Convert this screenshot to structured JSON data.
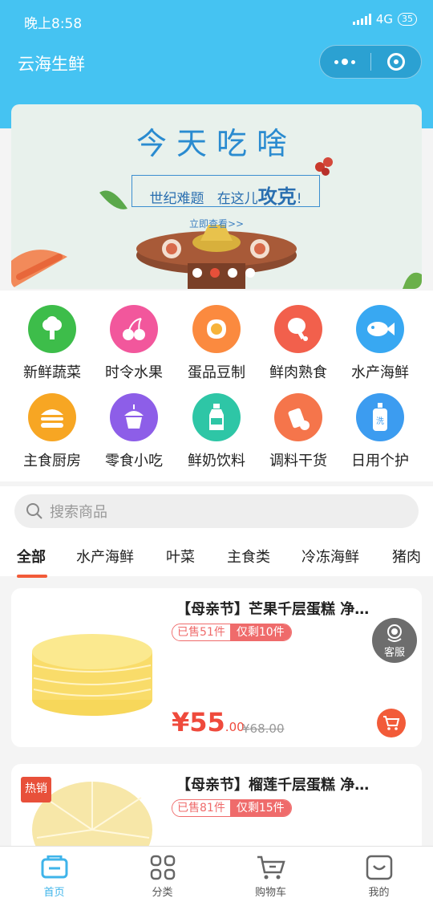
{
  "status": {
    "time": "晚上8:58",
    "network": "4G",
    "battery": "35"
  },
  "app": {
    "title": "云海生鲜"
  },
  "banner": {
    "title": "今天吃啥",
    "subtitle_left": "世纪难题",
    "subtitle_mid": "在这儿",
    "subtitle_strong": "攻克",
    "subtitle_end": "!",
    "link": "立即查看>>"
  },
  "categories": [
    {
      "label": "新鲜蔬菜",
      "color": "#3dbd4a",
      "icon": "broccoli-icon"
    },
    {
      "label": "时令水果",
      "color": "#f2579c",
      "icon": "cherry-icon"
    },
    {
      "label": "蛋品豆制",
      "color": "#fb8a3f",
      "icon": "egg-icon"
    },
    {
      "label": "鲜肉熟食",
      "color": "#f2604c",
      "icon": "drumstick-icon"
    },
    {
      "label": "水产海鲜",
      "color": "#38a8f2",
      "icon": "fish-icon"
    },
    {
      "label": "主食厨房",
      "color": "#f7a623",
      "icon": "burger-icon"
    },
    {
      "label": "零食小吃",
      "color": "#8d5ee8",
      "icon": "cupcake-icon"
    },
    {
      "label": "鲜奶饮料",
      "color": "#2ec6a6",
      "icon": "bottle-icon"
    },
    {
      "label": "调料干货",
      "color": "#f5754b",
      "icon": "seasoning-icon"
    },
    {
      "label": "日用个护",
      "color": "#3c9cf0",
      "icon": "wash-bottle-icon"
    }
  ],
  "search": {
    "placeholder": "搜索商品"
  },
  "tabs": [
    "全部",
    "水产海鲜",
    "叶菜",
    "主食类",
    "冷冻海鲜",
    "猪肉"
  ],
  "products": [
    {
      "title": "【母亲节】芒果千层蛋糕 净…",
      "sold": "已售51件",
      "left": "仅剩10件",
      "price_int": "¥55",
      "price_dec": ".00",
      "old_price": "¥68.00"
    },
    {
      "title": "【母亲节】榴莲千层蛋糕 净…",
      "sold": "已售81件",
      "left": "仅剩15件",
      "badge": "热销"
    }
  ],
  "service": {
    "label": "客服"
  },
  "tabbar": [
    {
      "label": "首页",
      "active": true
    },
    {
      "label": "分类"
    },
    {
      "label": "购物车"
    },
    {
      "label": "我的"
    }
  ],
  "colors": {
    "accent": "#45c3f2",
    "price": "#ef4a3c",
    "tag": "#ef6b6b"
  }
}
